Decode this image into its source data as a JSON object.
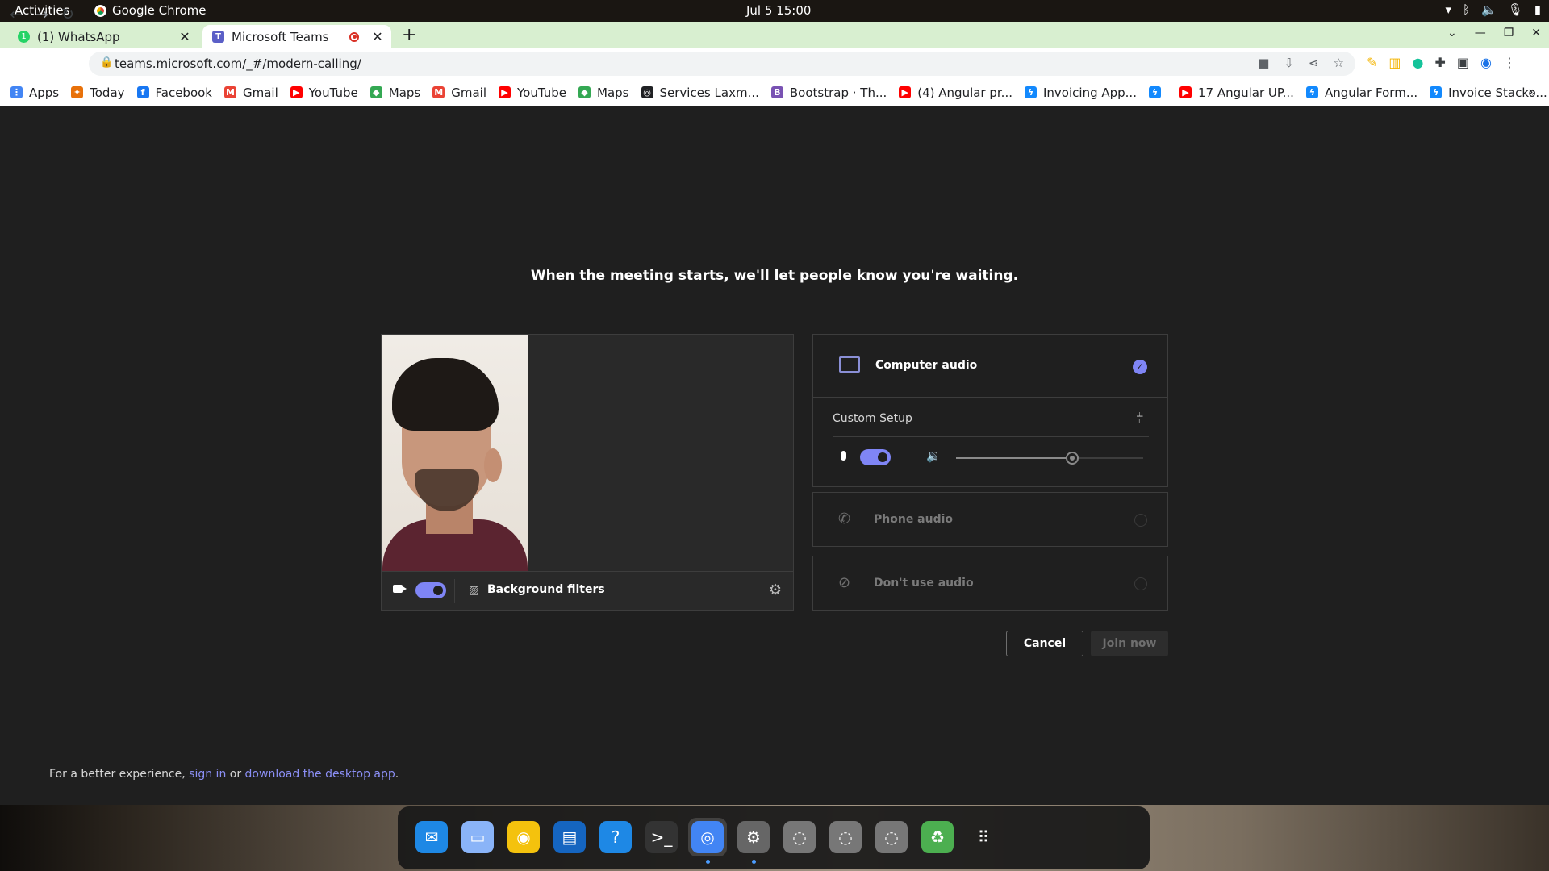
{
  "system_bar": {
    "activities": "Activities",
    "app_name": "Google Chrome",
    "clock": "Jul 5  15:00",
    "tray_icons": [
      "wifi-icon",
      "bluetooth-icon",
      "volume-icon",
      "mic-icon",
      "battery-icon"
    ]
  },
  "tabs": [
    {
      "title": "(1) WhatsApp",
      "icon": "whatsapp-icon",
      "active": false
    },
    {
      "title": "Microsoft Teams",
      "icon": "teams-icon",
      "active": true,
      "recording": true
    }
  ],
  "omnibox": {
    "url": "teams.microsoft.com/_#/modern-calling/"
  },
  "bookmarks": [
    {
      "label": "Apps",
      "icon": "apps-grid-icon",
      "color": "#4285f4"
    },
    {
      "label": "Today",
      "icon": "today-icon",
      "color": "#e8710a"
    },
    {
      "label": "Facebook",
      "icon": "facebook-icon",
      "color": "#1877f2"
    },
    {
      "label": "Gmail",
      "icon": "gmail-icon",
      "color": "#ea4335"
    },
    {
      "label": "YouTube",
      "icon": "youtube-icon",
      "color": "#ff0000"
    },
    {
      "label": "Maps",
      "icon": "maps-icon",
      "color": "#34a853"
    },
    {
      "label": "Gmail",
      "icon": "gmail-icon",
      "color": "#ea4335"
    },
    {
      "label": "YouTube",
      "icon": "youtube-icon",
      "color": "#ff0000"
    },
    {
      "label": "Maps",
      "icon": "maps-icon",
      "color": "#34a853"
    },
    {
      "label": "Services Laxm...",
      "icon": "globe-icon",
      "color": "#202124"
    },
    {
      "label": "Bootstrap · Th...",
      "icon": "bootstrap-icon",
      "color": "#7952b3"
    },
    {
      "label": "(4) Angular pr...",
      "icon": "youtube-icon",
      "color": "#ff0000"
    },
    {
      "label": "Invoicing App...",
      "icon": "stackblitz-icon",
      "color": "#1389fd"
    },
    {
      "label": "",
      "icon": "stackblitz-icon",
      "color": "#1389fd"
    },
    {
      "label": "17 Angular UP...",
      "icon": "youtube-icon",
      "color": "#ff0000"
    },
    {
      "label": "Angular Form...",
      "icon": "stackblitz-icon",
      "color": "#1389fd"
    },
    {
      "label": "Invoice Stacko...",
      "icon": "stackblitz-icon",
      "color": "#1389fd"
    }
  ],
  "teams": {
    "heading": "When the meeting starts, we'll let people know you're waiting.",
    "video": {
      "camera_on": true,
      "background_filters_label": "Background filters"
    },
    "audio": {
      "computer_audio_label": "Computer audio",
      "computer_audio_selected": true,
      "custom_setup_label": "Custom Setup",
      "mic_on": true,
      "speaker_volume": 0.62,
      "phone_audio_label": "Phone audio",
      "no_audio_label": "Don't use audio"
    },
    "buttons": {
      "cancel": "Cancel",
      "join": "Join now"
    },
    "footer": {
      "prefix": "For a better experience, ",
      "sign_in": "sign in",
      "middle": " or ",
      "download": "download the desktop app",
      "suffix": "."
    },
    "colors": {
      "accent": "#7f85f5",
      "background": "#1f1f1f"
    }
  },
  "dock": [
    {
      "name": "thunderbird-icon",
      "active": false
    },
    {
      "name": "files-icon",
      "active": false
    },
    {
      "name": "rhythmbox-icon",
      "active": false
    },
    {
      "name": "writer-icon",
      "active": false
    },
    {
      "name": "help-icon",
      "active": false
    },
    {
      "name": "terminal-icon",
      "active": false
    },
    {
      "name": "chrome-icon",
      "active": true
    },
    {
      "name": "settings-icon",
      "active": false
    },
    {
      "name": "disc-icon",
      "active": false
    },
    {
      "name": "disc-icon",
      "active": false
    },
    {
      "name": "disc-icon",
      "active": false
    },
    {
      "name": "trash-icon",
      "active": false
    },
    {
      "name": "show-apps-icon",
      "active": false
    }
  ]
}
